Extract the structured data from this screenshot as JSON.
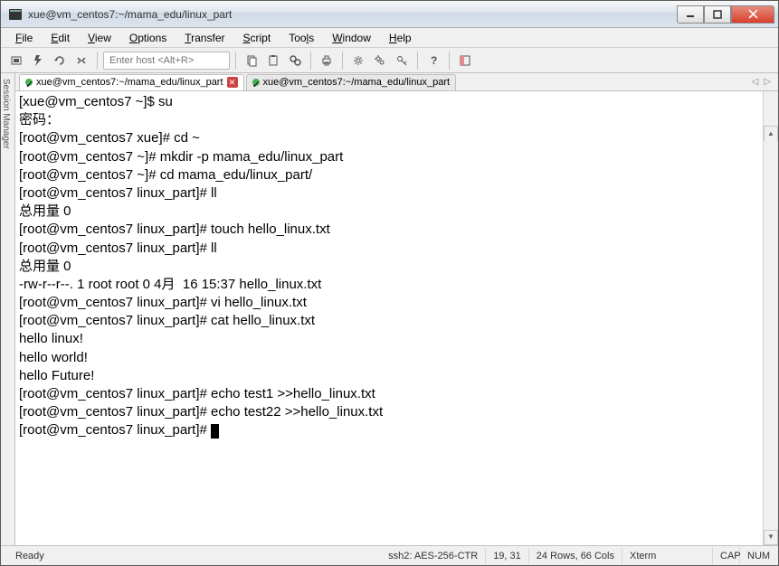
{
  "window": {
    "title": "xue@vm_centos7:~/mama_edu/linux_part"
  },
  "menubar": {
    "items": [
      {
        "label": "File",
        "key": "F"
      },
      {
        "label": "Edit",
        "key": "E"
      },
      {
        "label": "View",
        "key": "V"
      },
      {
        "label": "Options",
        "key": "O"
      },
      {
        "label": "Transfer",
        "key": "T"
      },
      {
        "label": "Script",
        "key": "S"
      },
      {
        "label": "Tools",
        "key": "T"
      },
      {
        "label": "Window",
        "key": "W"
      },
      {
        "label": "Help",
        "key": "H"
      }
    ]
  },
  "toolbar": {
    "host_placeholder": "Enter host <Alt+R>"
  },
  "sidebar": {
    "label": "Session Manager"
  },
  "tabs": [
    {
      "label": "xue@vm_centos7:~/mama_edu/linux_part",
      "active": true,
      "closable": true
    },
    {
      "label": "xue@vm_centos7:~/mama_edu/linux_part",
      "active": false,
      "closable": false
    }
  ],
  "terminal": {
    "lines": [
      "[xue@vm_centos7 ~]$ su",
      "密码：",
      "[root@vm_centos7 xue]# cd ~",
      "[root@vm_centos7 ~]# mkdir -p mama_edu/linux_part",
      "[root@vm_centos7 ~]# cd mama_edu/linux_part/",
      "[root@vm_centos7 linux_part]# ll",
      "总用量 0",
      "[root@vm_centos7 linux_part]# touch hello_linux.txt",
      "[root@vm_centos7 linux_part]# ll",
      "总用量 0",
      "-rw-r--r--. 1 root root 0 4月  16 15:37 hello_linux.txt",
      "[root@vm_centos7 linux_part]# vi hello_linux.txt",
      "[root@vm_centos7 linux_part]# cat hello_linux.txt",
      "hello linux!",
      "hello world!",
      "hello Future!",
      "[root@vm_centos7 linux_part]# echo test1 >>hello_linux.txt",
      "[root@vm_centos7 linux_part]# echo test22 >>hello_linux.txt",
      "[root@vm_centos7 linux_part]# "
    ]
  },
  "statusbar": {
    "ready": "Ready",
    "protocol": "ssh2: AES-256-CTR",
    "cursor_pos": "19,  31",
    "dims": "24 Rows, 66 Cols",
    "term": "Xterm",
    "cap": "CAP",
    "num": "NUM"
  }
}
